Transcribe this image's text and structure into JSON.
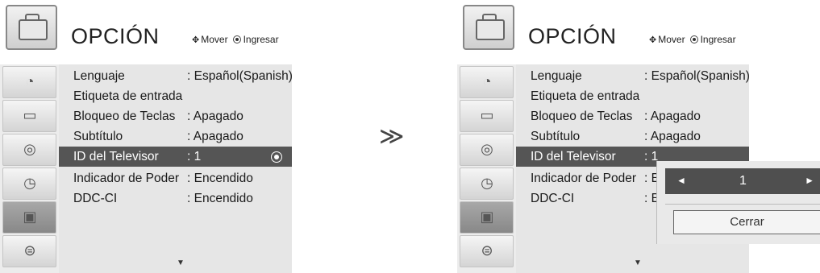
{
  "screens": [
    {
      "title": "OPCIÓN",
      "hint_move": "Mover",
      "hint_enter": "Ingresar",
      "items": [
        {
          "label": "Lenguaje",
          "value": ": Español(Spanish)"
        },
        {
          "label": "Etiqueta de entrada",
          "value": ""
        },
        {
          "label": "Bloqueo de Teclas",
          "value": ": Apagado"
        },
        {
          "label": "Subtítulo",
          "value": ": Apagado"
        },
        {
          "label": "ID del Televisor",
          "value": ": 1"
        },
        {
          "label": "Indicador de Poder",
          "value": ": Encendido"
        },
        {
          "label": "DDC-CI",
          "value": ": Encendido"
        }
      ]
    },
    {
      "title": "OPCIÓN",
      "hint_move": "Mover",
      "hint_enter": "Ingresar",
      "items": [
        {
          "label": "Lenguaje",
          "value": ": Español(Spanish)"
        },
        {
          "label": "Etiqueta de entrada",
          "value": ""
        },
        {
          "label": "Bloqueo de Teclas",
          "value": ": Apagado"
        },
        {
          "label": "Subtítulo",
          "value": ": Apagado"
        },
        {
          "label": "ID del Televisor",
          "value": ": 1"
        },
        {
          "label": "Indicador de Poder",
          "value": ": En"
        },
        {
          "label": "DDC-CI",
          "value": ": En"
        }
      ]
    }
  ],
  "transition_symbol": "≫",
  "popup": {
    "value": "1",
    "left_arrow": "◄",
    "right_arrow": "►",
    "close_label": "Cerrar"
  },
  "icons": {
    "left_arrow": "left-triangle-icon",
    "right_arrow": "right-triangle-icon",
    "down_arrow": "down-triangle-icon"
  }
}
